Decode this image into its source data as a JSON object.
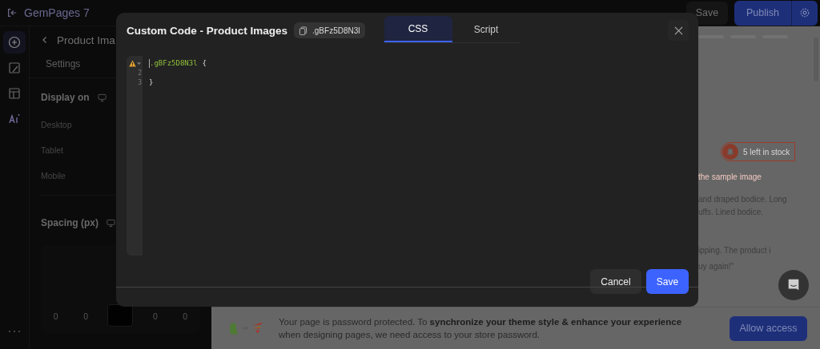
{
  "topbar": {
    "app_name": "GemPages 7",
    "save": "Save",
    "publish": "Publish"
  },
  "sidebar": {
    "title": "Product Ima",
    "tabs": [
      {
        "label": "Settings",
        "selected": false
      }
    ],
    "display_on": {
      "heading": "Display on",
      "options": [
        "Desktop",
        "Tablet",
        "Mobile"
      ]
    },
    "spacing": {
      "heading": "Spacing (px)",
      "values": [
        "0",
        "0",
        "0",
        "0"
      ]
    }
  },
  "modal": {
    "title": "Custom Code - Product Images",
    "class_name": ".gBFz5D8N3l",
    "tabs": [
      {
        "label": "CSS",
        "selected": true
      },
      {
        "label": "Script",
        "selected": false
      }
    ],
    "editor_lines": [
      {
        "warning": true,
        "tokens": [
          {
            "kind": "selector",
            "text": ".gBFz5D8N3l"
          },
          {
            "kind": "punct",
            "text": "{"
          }
        ]
      },
      {
        "number": "2",
        "warning": false
      },
      {
        "number": "3",
        "warning": false,
        "tokens": [
          {
            "kind": "punct",
            "text": "}"
          }
        ]
      }
    ],
    "buttons": {
      "cancel": "Cancel",
      "save": "Save"
    }
  },
  "preview": {
    "stock_badge": "5 left in stock",
    "lines": [
      {
        "kind": "accent",
        "text": "the sample image"
      },
      {
        "kind": "body",
        "text": "and draped bodice. Long"
      },
      {
        "kind": "body",
        "text": "uffs. Lined bodice."
      },
      {
        "kind": "quote",
        "text": "ipping. The product i"
      },
      {
        "kind": "quote",
        "text": "uy again!\""
      }
    ]
  },
  "banner": {
    "text": "Your page is password protected. To **synchronize your theme style & enhance your experience** when designing pages, we need access to your store password.",
    "button": "Allow access"
  }
}
